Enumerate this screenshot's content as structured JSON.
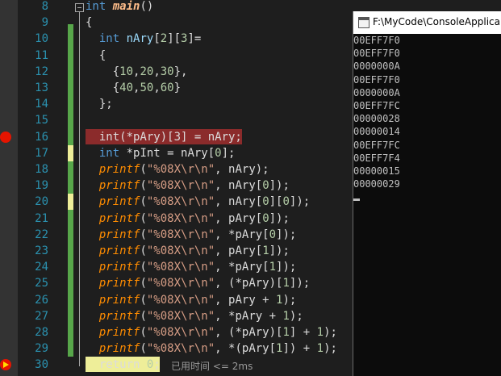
{
  "editor": {
    "line_numbers": [
      "8",
      "9",
      "10",
      "11",
      "12",
      "13",
      "14",
      "15",
      "16",
      "17",
      "18",
      "19",
      "20",
      "21",
      "22",
      "23",
      "24",
      "25",
      "26",
      "27",
      "28",
      "29",
      "30"
    ],
    "lines": [
      {
        "parts": [
          [
            "kw",
            "int"
          ],
          [
            "txt",
            " "
          ],
          [
            "fn",
            "main"
          ],
          [
            "txt",
            "()"
          ]
        ]
      },
      {
        "parts": [
          [
            "txt",
            "{"
          ]
        ]
      },
      {
        "parts": [
          [
            "txt",
            "  "
          ],
          [
            "kw",
            "int"
          ],
          [
            "txt",
            " "
          ],
          [
            "var",
            "nAry"
          ],
          [
            "txt",
            "["
          ],
          [
            "num",
            "2"
          ],
          [
            "txt",
            "]["
          ],
          [
            "num",
            "3"
          ],
          [
            "txt",
            "]="
          ]
        ]
      },
      {
        "parts": [
          [
            "txt",
            "  {"
          ]
        ]
      },
      {
        "parts": [
          [
            "txt",
            "    {"
          ],
          [
            "num",
            "10"
          ],
          [
            "txt",
            ","
          ],
          [
            "num",
            "20"
          ],
          [
            "txt",
            ","
          ],
          [
            "num",
            "30"
          ],
          [
            "txt",
            "},"
          ]
        ]
      },
      {
        "parts": [
          [
            "txt",
            "    {"
          ],
          [
            "num",
            "40"
          ],
          [
            "txt",
            ","
          ],
          [
            "num",
            "50"
          ],
          [
            "txt",
            ","
          ],
          [
            "num",
            "60"
          ],
          [
            "txt",
            "}"
          ]
        ]
      },
      {
        "parts": [
          [
            "txt",
            "  };"
          ]
        ]
      },
      {
        "parts": [
          [
            "txt",
            ""
          ]
        ]
      },
      {
        "parts": [
          [
            "txt",
            "  int(*pAry)[3] = nAry;"
          ]
        ]
      },
      {
        "parts": [
          [
            "txt",
            "  "
          ],
          [
            "kw",
            "int"
          ],
          [
            "txt",
            " *pInt = nAry["
          ],
          [
            "num",
            "0"
          ],
          [
            "txt",
            "];"
          ]
        ]
      },
      {
        "parts": [
          [
            "txt",
            "  "
          ],
          [
            "fnc",
            "printf"
          ],
          [
            "txt",
            "("
          ],
          [
            "str",
            "\"%08X\\r\\n\""
          ],
          [
            "txt",
            ", nAry);"
          ]
        ]
      },
      {
        "parts": [
          [
            "txt",
            "  "
          ],
          [
            "fnc",
            "printf"
          ],
          [
            "txt",
            "("
          ],
          [
            "str",
            "\"%08X\\r\\n\""
          ],
          [
            "txt",
            ", nAry["
          ],
          [
            "num",
            "0"
          ],
          [
            "txt",
            "]);"
          ]
        ]
      },
      {
        "parts": [
          [
            "txt",
            "  "
          ],
          [
            "fnc",
            "printf"
          ],
          [
            "txt",
            "("
          ],
          [
            "str",
            "\"%08X\\r\\n\""
          ],
          [
            "txt",
            ", nAry["
          ],
          [
            "num",
            "0"
          ],
          [
            "txt",
            "]["
          ],
          [
            "num",
            "0"
          ],
          [
            "txt",
            "]);"
          ]
        ]
      },
      {
        "parts": [
          [
            "txt",
            "  "
          ],
          [
            "fnc",
            "printf"
          ],
          [
            "txt",
            "("
          ],
          [
            "str",
            "\"%08X\\r\\n\""
          ],
          [
            "txt",
            ", pAry["
          ],
          [
            "num",
            "0"
          ],
          [
            "txt",
            "]);"
          ]
        ]
      },
      {
        "parts": [
          [
            "txt",
            "  "
          ],
          [
            "fnc",
            "printf"
          ],
          [
            "txt",
            "("
          ],
          [
            "str",
            "\"%08X\\r\\n\""
          ],
          [
            "txt",
            ", *pAry["
          ],
          [
            "num",
            "0"
          ],
          [
            "txt",
            "]);"
          ]
        ]
      },
      {
        "parts": [
          [
            "txt",
            "  "
          ],
          [
            "fnc",
            "printf"
          ],
          [
            "txt",
            "("
          ],
          [
            "str",
            "\"%08X\\r\\n\""
          ],
          [
            "txt",
            ", pAry["
          ],
          [
            "num",
            "1"
          ],
          [
            "txt",
            "]);"
          ]
        ]
      },
      {
        "parts": [
          [
            "txt",
            "  "
          ],
          [
            "fnc",
            "printf"
          ],
          [
            "txt",
            "("
          ],
          [
            "str",
            "\"%08X\\r\\n\""
          ],
          [
            "txt",
            ", *pAry["
          ],
          [
            "num",
            "1"
          ],
          [
            "txt",
            "]);"
          ]
        ]
      },
      {
        "parts": [
          [
            "txt",
            "  "
          ],
          [
            "fnc",
            "printf"
          ],
          [
            "txt",
            "("
          ],
          [
            "str",
            "\"%08X\\r\\n\""
          ],
          [
            "txt",
            ", (*pAry)["
          ],
          [
            "num",
            "1"
          ],
          [
            "txt",
            "]);"
          ]
        ]
      },
      {
        "parts": [
          [
            "txt",
            "  "
          ],
          [
            "fnc",
            "printf"
          ],
          [
            "txt",
            "("
          ],
          [
            "str",
            "\"%08X\\r\\n\""
          ],
          [
            "txt",
            ", pAry + "
          ],
          [
            "num",
            "1"
          ],
          [
            "txt",
            ");"
          ]
        ]
      },
      {
        "parts": [
          [
            "txt",
            "  "
          ],
          [
            "fnc",
            "printf"
          ],
          [
            "txt",
            "("
          ],
          [
            "str",
            "\"%08X\\r\\n\""
          ],
          [
            "txt",
            ", *pAry + "
          ],
          [
            "num",
            "1"
          ],
          [
            "txt",
            ");"
          ]
        ]
      },
      {
        "parts": [
          [
            "txt",
            "  "
          ],
          [
            "fnc",
            "printf"
          ],
          [
            "txt",
            "("
          ],
          [
            "str",
            "\"%08X\\r\\n\""
          ],
          [
            "txt",
            ", (*pAry)["
          ],
          [
            "num",
            "1"
          ],
          [
            "txt",
            "] + "
          ],
          [
            "num",
            "1"
          ],
          [
            "txt",
            ");"
          ]
        ]
      },
      {
        "parts": [
          [
            "txt",
            "  "
          ],
          [
            "fnc",
            "printf"
          ],
          [
            "txt",
            "("
          ],
          [
            "str",
            "\"%08X\\r\\n\""
          ],
          [
            "txt",
            ", *(pAry["
          ],
          [
            "num",
            "1"
          ],
          [
            "txt",
            "]) + "
          ],
          [
            "num",
            "1"
          ],
          [
            "txt",
            ");"
          ]
        ]
      },
      {
        "parts": [
          [
            "txt",
            "  return "
          ],
          [
            "num",
            "0"
          ],
          [
            "txt",
            ";"
          ]
        ]
      }
    ],
    "timing_text": "已用时间 <= 2ms",
    "colors": {
      "breakpoint": "#e51400",
      "change_saved": "#57a64a",
      "change_unsaved": "#eeee99"
    }
  },
  "console": {
    "title": "F:\\MyCode\\ConsoleApplica",
    "output_lines": [
      "00EFF7F0",
      "00EFF7F0",
      "0000000A",
      "00EFF7F0",
      "0000000A",
      "00EFF7FC",
      "00000028",
      "00000014",
      "00EFF7FC",
      "00EFF7F4",
      "00000015",
      "00000029"
    ]
  }
}
